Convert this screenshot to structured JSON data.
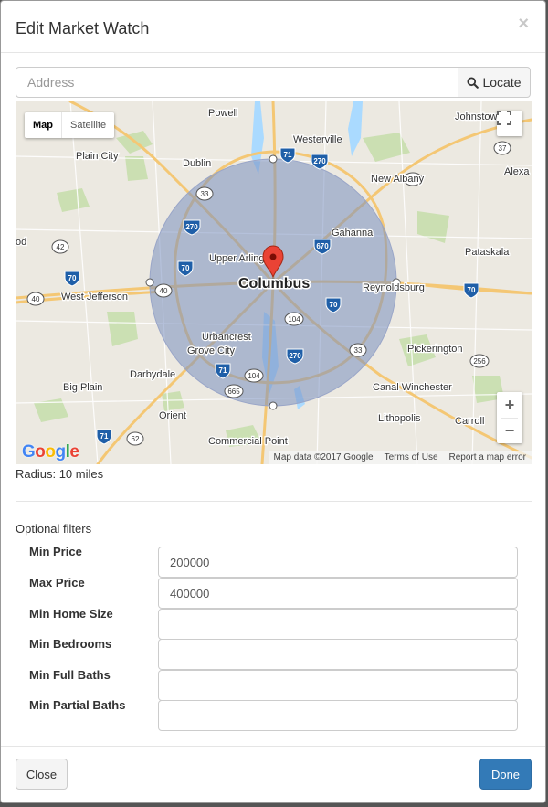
{
  "dialog": {
    "title": "Edit Market Watch",
    "close_glyph": "×"
  },
  "address": {
    "placeholder": "Address",
    "value": "",
    "locate_label": "Locate",
    "locate_icon": "search-icon"
  },
  "map": {
    "map_tab": "Map",
    "satellite_tab": "Satellite",
    "active_tab": "Map",
    "zoom_in": "+",
    "zoom_out": "−",
    "fullscreen_icon": "fullscreen-icon",
    "logo_text": "Google",
    "attribution": {
      "data": "Map data ©2017 Google",
      "terms": "Terms of Use",
      "report": "Report a map error"
    },
    "center_label": "Columbus",
    "place_labels": [
      "Powell",
      "Westerville",
      "Johnstown",
      "Plain City",
      "Dublin",
      "New Albany",
      "Alexa",
      "Gahanna",
      "Upper Arlington",
      "Pataskala",
      "West Jefferson",
      "Reynoldsburg",
      "Urbancrest",
      "Grove City",
      "Pickerington",
      "Darbydale",
      "Big Plain",
      "Canal Winchester",
      "Orient",
      "Lithopolis",
      "Carroll",
      "Commercial Point",
      "od"
    ],
    "road_shields": [
      "71",
      "270",
      "37",
      "33",
      "161",
      "270",
      "42",
      "670",
      "70",
      "40",
      "40",
      "70",
      "70",
      "104",
      "270",
      "33",
      "71",
      "104",
      "256",
      "665",
      "71",
      "62"
    ],
    "circle_fill": "#7a8fbf",
    "marker_color": "#ea4335"
  },
  "radius": {
    "text": "Radius: 10 miles"
  },
  "filters": {
    "title": "Optional filters",
    "rows": [
      {
        "label": "Min Price",
        "value": "200000"
      },
      {
        "label": "Max Price",
        "value": "400000"
      },
      {
        "label": "Min Home Size",
        "value": ""
      },
      {
        "label": "Min Bedrooms",
        "value": ""
      },
      {
        "label": "Min Full Baths",
        "value": ""
      },
      {
        "label": "Min Partial Baths",
        "value": ""
      }
    ]
  },
  "footer": {
    "close_label": "Close",
    "done_label": "Done"
  },
  "colors": {
    "primary": "#337ab7",
    "map_background": "#ece9e1",
    "highway": "#f4c774",
    "interstate_shield": "#1f5fa8"
  }
}
